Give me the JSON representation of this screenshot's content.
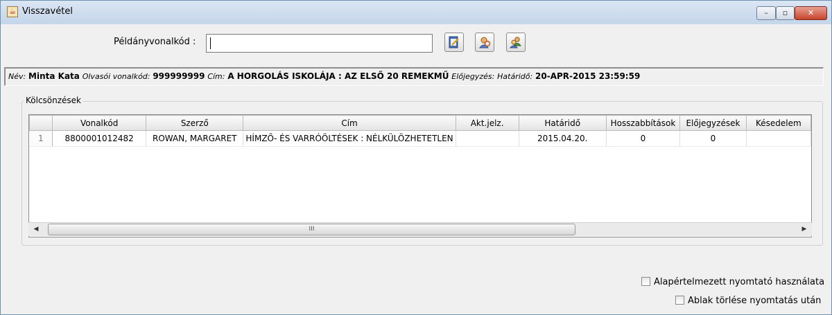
{
  "window": {
    "title": "Visszavétel",
    "controls": {
      "minimize": "–",
      "maximize": "▫",
      "close": "✕"
    }
  },
  "toolbar": {
    "barcode_label": "Példányvonalkód :",
    "barcode_value": "",
    "buttons": [
      {
        "name": "edit-record-button",
        "icon": "notepad-edit-icon"
      },
      {
        "name": "reader-search-button",
        "icon": "person-search-icon"
      },
      {
        "name": "reader-group-button",
        "icon": "people-icon"
      }
    ]
  },
  "info": {
    "name_key": "Név:",
    "name_val": "Minta Kata",
    "reader_key": "Olvasói vonalkód:",
    "reader_val": "999999999",
    "title_key": "Cím:",
    "title_val": "A HORGOLÁS ISKOLÁJA : AZ ELSŐ 20 REMEKMŰ",
    "reservation_key": "Előjegyzés:",
    "deadline_key": "Határidő:",
    "deadline_val": "20-APR-2015 23:59:59"
  },
  "loans": {
    "group_title": "Kölcsönzések",
    "columns": [
      "",
      "Vonalkód",
      "Szerző",
      "Cím",
      "Akt.jelz.",
      "Határidő",
      "Hosszabbítások",
      "Előjegyzések",
      "Késedelem"
    ],
    "rows": [
      [
        "1",
        "8800001012482",
        "ROWAN, MARGARET",
        "HÍMZŐ- ÉS VARRÓÖLTÉSEK : NÉLKÜLÖZHETETLEN",
        "",
        "2015.04.20.",
        "0",
        "0",
        ""
      ]
    ],
    "scroll_thumb_label": "III"
  },
  "options": {
    "default_printer_label": "Alapértelmezett nyomtató használata",
    "default_printer_checked": false,
    "clear_after_print_label": "Ablak törlése nyomtatás után",
    "clear_after_print_checked": false
  }
}
